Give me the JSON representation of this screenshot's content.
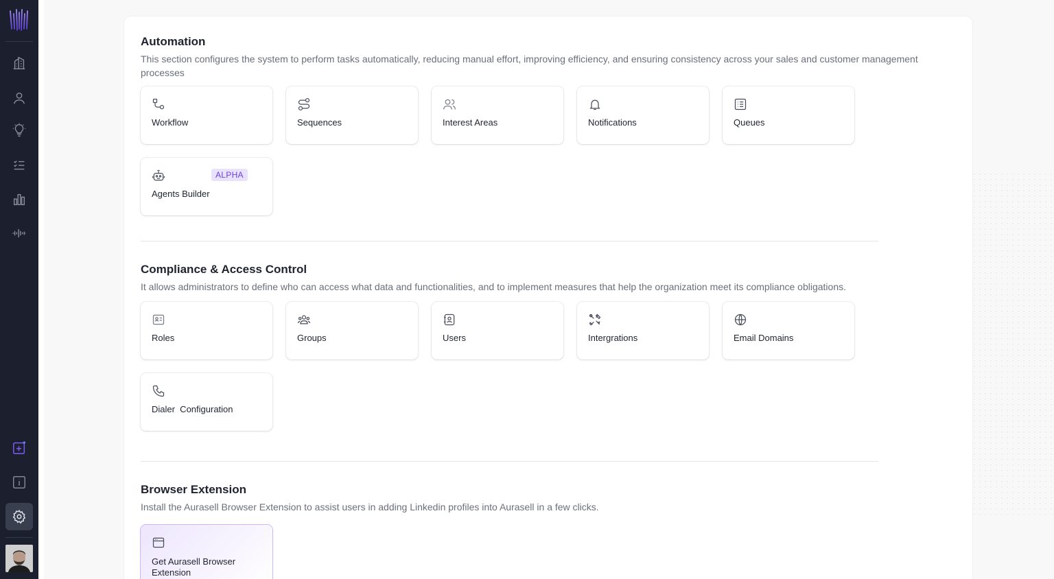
{
  "sidebar": {
    "logo_icon": "aurasell-logo-icon",
    "items": [
      {
        "icon": "building-icon"
      },
      {
        "icon": "user-icon"
      },
      {
        "icon": "lightbulb-icon"
      },
      {
        "icon": "checklist-icon"
      },
      {
        "icon": "bar-chart-icon"
      },
      {
        "icon": "waveform-icon"
      }
    ],
    "bottom_items": [
      {
        "icon": "add-sparkle-icon"
      },
      {
        "icon": "info-icon"
      },
      {
        "icon": "gear-icon",
        "active": true
      }
    ],
    "accent": "#7b5cf5"
  },
  "sections": {
    "automation": {
      "title": "Automation",
      "description": "This section configures the system to perform tasks automatically, reducing manual effort, improving efficiency, and ensuring consistency across your sales and customer management processes",
      "cards": [
        {
          "label": "Workflow",
          "icon": "workflow-icon"
        },
        {
          "label": "Sequences",
          "icon": "sequences-icon"
        },
        {
          "label": "Interest Areas",
          "icon": "users-icon"
        },
        {
          "label": "Notifications",
          "icon": "bell-icon"
        },
        {
          "label": "Queues",
          "icon": "list-icon"
        },
        {
          "label": "Agents Builder",
          "icon": "robot-icon",
          "badge": "ALPHA"
        }
      ]
    },
    "compliance": {
      "title": "Compliance & Access Control",
      "description": "It allows administrators to define who can access what data and functionalities, and to implement measures that help the organization meet its compliance obligations.",
      "cards": [
        {
          "label": "Roles",
          "icon": "id-card-icon"
        },
        {
          "label": "Groups",
          "icon": "group-icon"
        },
        {
          "label": "Users",
          "icon": "contact-book-icon"
        },
        {
          "label": "Intergrations",
          "icon": "tools-icon"
        },
        {
          "label": "Email Domains",
          "icon": "globe-icon"
        },
        {
          "label": "Dialer  Configuration",
          "icon": "phone-icon"
        }
      ]
    },
    "browser_extension": {
      "title": "Browser Extension",
      "description": "Install the Aurasell Browser Extension to assist users in adding Linkedin profiles into Aurasell in a few clicks.",
      "cards": [
        {
          "label": "Get Aurasell Browser Extension",
          "icon": "browser-window-icon"
        }
      ]
    }
  },
  "colors": {
    "sidebar_bg": "#1c1f2e",
    "badge_bg": "#e9e2fd",
    "badge_text": "#6c3fe0"
  }
}
